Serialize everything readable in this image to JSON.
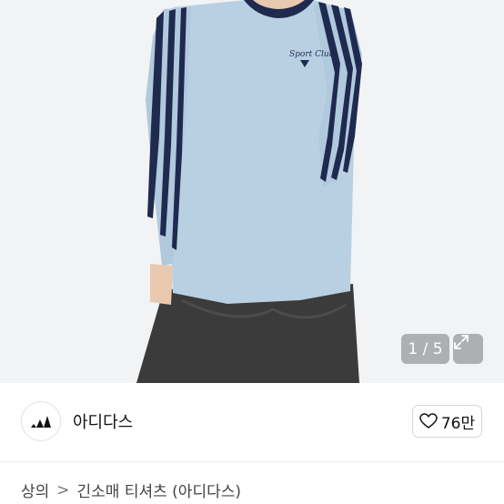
{
  "gallery": {
    "counter_text": "1 / 5",
    "expand_icon": "expand-icon"
  },
  "seller": {
    "logo_icon": "adidas-logo-icon",
    "brand_name": "아디다스",
    "like_icon": "heart-icon",
    "like_count": "76만"
  },
  "breadcrumb": {
    "level1": "상의",
    "separator": ">",
    "level2": "긴소매 티셔츠 (아디다스)"
  },
  "colors": {
    "shirt": "#b8cfe0",
    "stripe": "#1f2a4f",
    "pants": "#3d3d3d"
  }
}
